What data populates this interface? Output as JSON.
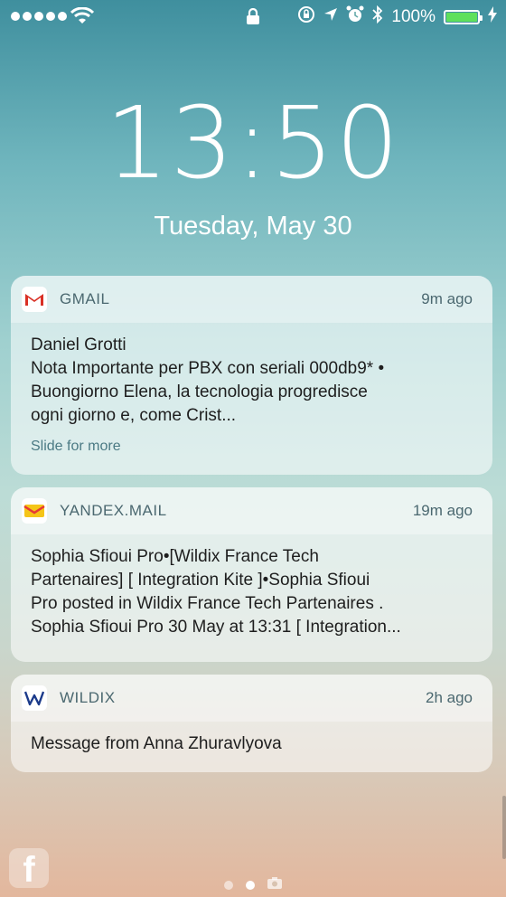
{
  "status_bar": {
    "battery_text": "100%",
    "battery_level": 1.0,
    "battery_color": "#5fe05c",
    "signal_bars": 5
  },
  "clock": {
    "time": "13:50",
    "date": "Tuesday, May 30"
  },
  "notifications": [
    {
      "app": "GMAIL",
      "time": "9m ago",
      "icon": "gmail-icon",
      "lines": [
        "Daniel Grotti",
        "Nota Importante per PBX con seriali 000db9*  •",
        "Buongiorno Elena, la tecnologia progredisce",
        "ogni giorno e, come Crist..."
      ],
      "more": "Slide for more"
    },
    {
      "app": "YANDEX.MAIL",
      "time": "19m ago",
      "icon": "yandex-mail-icon",
      "lines": [
        "Sophia Sfioui Pro•[Wildix France Tech",
        "Partenaires] [ Integration Kite ]•Sophia Sfioui",
        "Pro posted in Wildix France Tech Partenaires .",
        "Sophia Sfioui Pro 30 May at 13:31 [ Integration..."
      ]
    },
    {
      "app": "WILDIX",
      "time": "2h ago",
      "icon": "wildix-icon",
      "lines": [
        "Message from Anna Zhuravlyova"
      ]
    }
  ],
  "bottom": {
    "page_count": 3,
    "active_page": 1,
    "app_shortcut": "facebook-icon"
  }
}
